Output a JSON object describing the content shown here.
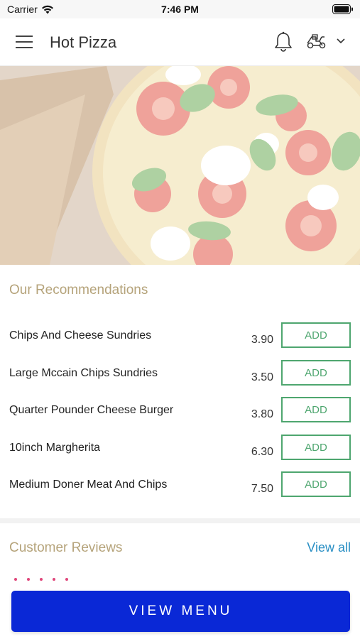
{
  "status_bar": {
    "carrier": "Carrier",
    "time": "7:46 PM"
  },
  "header": {
    "title": "Hot Pizza"
  },
  "recommendations": {
    "title": "Our Recommendations",
    "items": [
      {
        "name": "Chips And Cheese Sundries",
        "price": "3.90",
        "action": "ADD"
      },
      {
        "name": "Large Mccain Chips Sundries",
        "price": "3.50",
        "action": "ADD"
      },
      {
        "name": "Quarter Pounder Cheese Burger",
        "price": "3.80",
        "action": "ADD"
      },
      {
        "name": "10inch Margherita",
        "price": "6.30",
        "action": "ADD"
      },
      {
        "name": "Medium Doner Meat And Chips",
        "price": "7.50",
        "action": "ADD"
      }
    ]
  },
  "reviews": {
    "title": "Customer Reviews",
    "view_all": "View all"
  },
  "footer": {
    "view_menu": "VIEW MENU"
  },
  "colors": {
    "accent_gold": "#b5a37a",
    "add_green": "#4ea66f",
    "link_blue": "#2a8fc4",
    "primary_blue": "#0a28d6"
  },
  "icons": [
    "wifi-icon",
    "battery-icon",
    "menu-icon",
    "bell-icon",
    "delivery-scooter-icon",
    "chevron-down-icon"
  ]
}
